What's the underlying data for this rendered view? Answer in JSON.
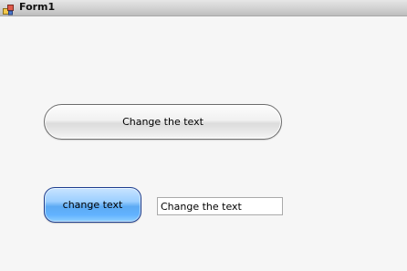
{
  "window": {
    "title": "Form1",
    "icon": "form-app-icon"
  },
  "buttons": {
    "change_the_text_label": "Change the text",
    "change_text_label": "change text"
  },
  "textbox": {
    "value": "Change the text"
  },
  "colors": {
    "blue_button": "#62b3ff",
    "gray_button": "#e9e9e9"
  }
}
